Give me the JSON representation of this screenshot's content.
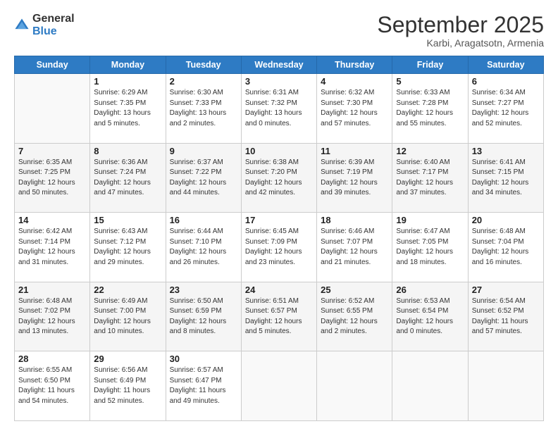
{
  "header": {
    "logo_general": "General",
    "logo_blue": "Blue",
    "month_title": "September 2025",
    "location": "Karbi, Aragatsotn, Armenia"
  },
  "days_of_week": [
    "Sunday",
    "Monday",
    "Tuesday",
    "Wednesday",
    "Thursday",
    "Friday",
    "Saturday"
  ],
  "weeks": [
    [
      {
        "day": "",
        "info": ""
      },
      {
        "day": "1",
        "info": "Sunrise: 6:29 AM\nSunset: 7:35 PM\nDaylight: 13 hours\nand 5 minutes."
      },
      {
        "day": "2",
        "info": "Sunrise: 6:30 AM\nSunset: 7:33 PM\nDaylight: 13 hours\nand 2 minutes."
      },
      {
        "day": "3",
        "info": "Sunrise: 6:31 AM\nSunset: 7:32 PM\nDaylight: 13 hours\nand 0 minutes."
      },
      {
        "day": "4",
        "info": "Sunrise: 6:32 AM\nSunset: 7:30 PM\nDaylight: 12 hours\nand 57 minutes."
      },
      {
        "day": "5",
        "info": "Sunrise: 6:33 AM\nSunset: 7:28 PM\nDaylight: 12 hours\nand 55 minutes."
      },
      {
        "day": "6",
        "info": "Sunrise: 6:34 AM\nSunset: 7:27 PM\nDaylight: 12 hours\nand 52 minutes."
      }
    ],
    [
      {
        "day": "7",
        "info": "Sunrise: 6:35 AM\nSunset: 7:25 PM\nDaylight: 12 hours\nand 50 minutes."
      },
      {
        "day": "8",
        "info": "Sunrise: 6:36 AM\nSunset: 7:24 PM\nDaylight: 12 hours\nand 47 minutes."
      },
      {
        "day": "9",
        "info": "Sunrise: 6:37 AM\nSunset: 7:22 PM\nDaylight: 12 hours\nand 44 minutes."
      },
      {
        "day": "10",
        "info": "Sunrise: 6:38 AM\nSunset: 7:20 PM\nDaylight: 12 hours\nand 42 minutes."
      },
      {
        "day": "11",
        "info": "Sunrise: 6:39 AM\nSunset: 7:19 PM\nDaylight: 12 hours\nand 39 minutes."
      },
      {
        "day": "12",
        "info": "Sunrise: 6:40 AM\nSunset: 7:17 PM\nDaylight: 12 hours\nand 37 minutes."
      },
      {
        "day": "13",
        "info": "Sunrise: 6:41 AM\nSunset: 7:15 PM\nDaylight: 12 hours\nand 34 minutes."
      }
    ],
    [
      {
        "day": "14",
        "info": "Sunrise: 6:42 AM\nSunset: 7:14 PM\nDaylight: 12 hours\nand 31 minutes."
      },
      {
        "day": "15",
        "info": "Sunrise: 6:43 AM\nSunset: 7:12 PM\nDaylight: 12 hours\nand 29 minutes."
      },
      {
        "day": "16",
        "info": "Sunrise: 6:44 AM\nSunset: 7:10 PM\nDaylight: 12 hours\nand 26 minutes."
      },
      {
        "day": "17",
        "info": "Sunrise: 6:45 AM\nSunset: 7:09 PM\nDaylight: 12 hours\nand 23 minutes."
      },
      {
        "day": "18",
        "info": "Sunrise: 6:46 AM\nSunset: 7:07 PM\nDaylight: 12 hours\nand 21 minutes."
      },
      {
        "day": "19",
        "info": "Sunrise: 6:47 AM\nSunset: 7:05 PM\nDaylight: 12 hours\nand 18 minutes."
      },
      {
        "day": "20",
        "info": "Sunrise: 6:48 AM\nSunset: 7:04 PM\nDaylight: 12 hours\nand 16 minutes."
      }
    ],
    [
      {
        "day": "21",
        "info": "Sunrise: 6:48 AM\nSunset: 7:02 PM\nDaylight: 12 hours\nand 13 minutes."
      },
      {
        "day": "22",
        "info": "Sunrise: 6:49 AM\nSunset: 7:00 PM\nDaylight: 12 hours\nand 10 minutes."
      },
      {
        "day": "23",
        "info": "Sunrise: 6:50 AM\nSunset: 6:59 PM\nDaylight: 12 hours\nand 8 minutes."
      },
      {
        "day": "24",
        "info": "Sunrise: 6:51 AM\nSunset: 6:57 PM\nDaylight: 12 hours\nand 5 minutes."
      },
      {
        "day": "25",
        "info": "Sunrise: 6:52 AM\nSunset: 6:55 PM\nDaylight: 12 hours\nand 2 minutes."
      },
      {
        "day": "26",
        "info": "Sunrise: 6:53 AM\nSunset: 6:54 PM\nDaylight: 12 hours\nand 0 minutes."
      },
      {
        "day": "27",
        "info": "Sunrise: 6:54 AM\nSunset: 6:52 PM\nDaylight: 11 hours\nand 57 minutes."
      }
    ],
    [
      {
        "day": "28",
        "info": "Sunrise: 6:55 AM\nSunset: 6:50 PM\nDaylight: 11 hours\nand 54 minutes."
      },
      {
        "day": "29",
        "info": "Sunrise: 6:56 AM\nSunset: 6:49 PM\nDaylight: 11 hours\nand 52 minutes."
      },
      {
        "day": "30",
        "info": "Sunrise: 6:57 AM\nSunset: 6:47 PM\nDaylight: 11 hours\nand 49 minutes."
      },
      {
        "day": "",
        "info": ""
      },
      {
        "day": "",
        "info": ""
      },
      {
        "day": "",
        "info": ""
      },
      {
        "day": "",
        "info": ""
      }
    ]
  ]
}
